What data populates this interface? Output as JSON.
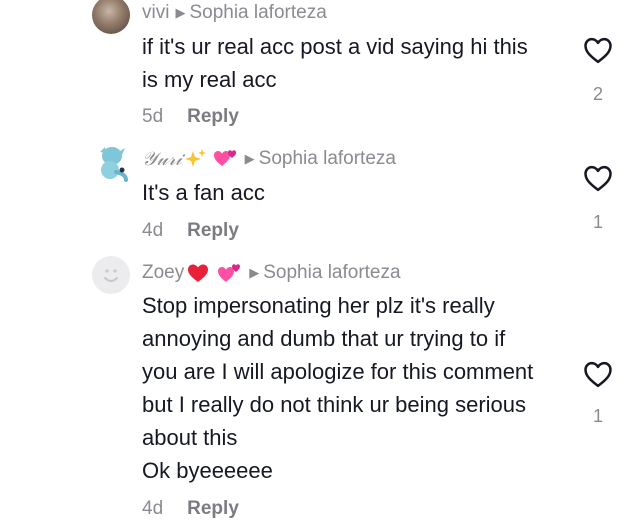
{
  "comments": [
    {
      "username": "vivi",
      "reply_to": "Sophia laforteza",
      "text_lines": [
        "if it's ur real acc post a vid saying hi this",
        "is my real acc"
      ],
      "age": "5d",
      "reply_label": "Reply",
      "likes": "2"
    },
    {
      "username": "𝒴𝓊𝓇𝒾",
      "reply_to": "Sophia laforteza",
      "text_lines": [
        "It's a fan acc"
      ],
      "age": "4d",
      "reply_label": "Reply",
      "likes": "1"
    },
    {
      "username": "Zoey",
      "reply_to": "Sophia laforteza",
      "text_lines": [
        "Stop impersonating her plz it's really",
        "annoying and dumb that ur trying to if",
        "you are I will apologize for this comment",
        "but I really do not think ur being serious",
        "about this",
        "Ok byeeeeee"
      ],
      "age": "4d",
      "reply_label": "Reply",
      "likes": "1"
    }
  ],
  "colors": {
    "text": "#161823",
    "meta": "#8a8b91",
    "heart_red": "#e8203a",
    "heart_pink": "#ff4fa3"
  },
  "icons": {
    "reply_arrow": "caret-right-icon",
    "like": "heart-outline-icon"
  }
}
